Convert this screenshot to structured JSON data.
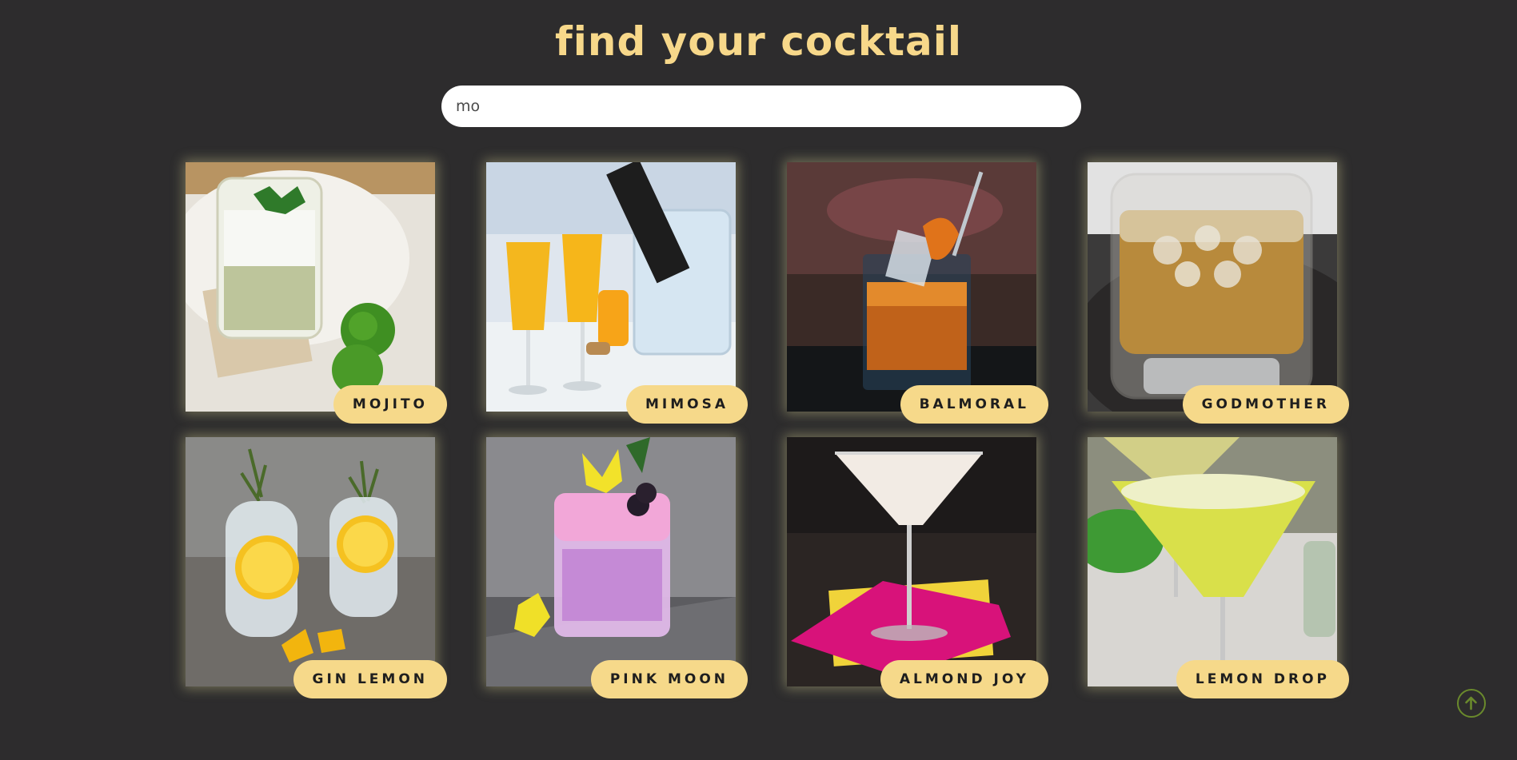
{
  "header": {
    "title": "find your cocktail"
  },
  "search": {
    "value": "mo"
  },
  "cocktails": [
    {
      "name": "MOJITO"
    },
    {
      "name": "MIMOSA"
    },
    {
      "name": "BALMORAL"
    },
    {
      "name": "GODMOTHER"
    },
    {
      "name": "GIN LEMON"
    },
    {
      "name": "PINK MOON"
    },
    {
      "name": "ALMOND JOY"
    },
    {
      "name": "LEMON DROP"
    }
  ],
  "scroll_top": {
    "icon": "arrow-up-circle-icon"
  },
  "colors": {
    "background": "#2d2c2d",
    "accent": "#f6d98a",
    "title": "#f7d88a",
    "scroll_top": "#6a8a2c"
  }
}
